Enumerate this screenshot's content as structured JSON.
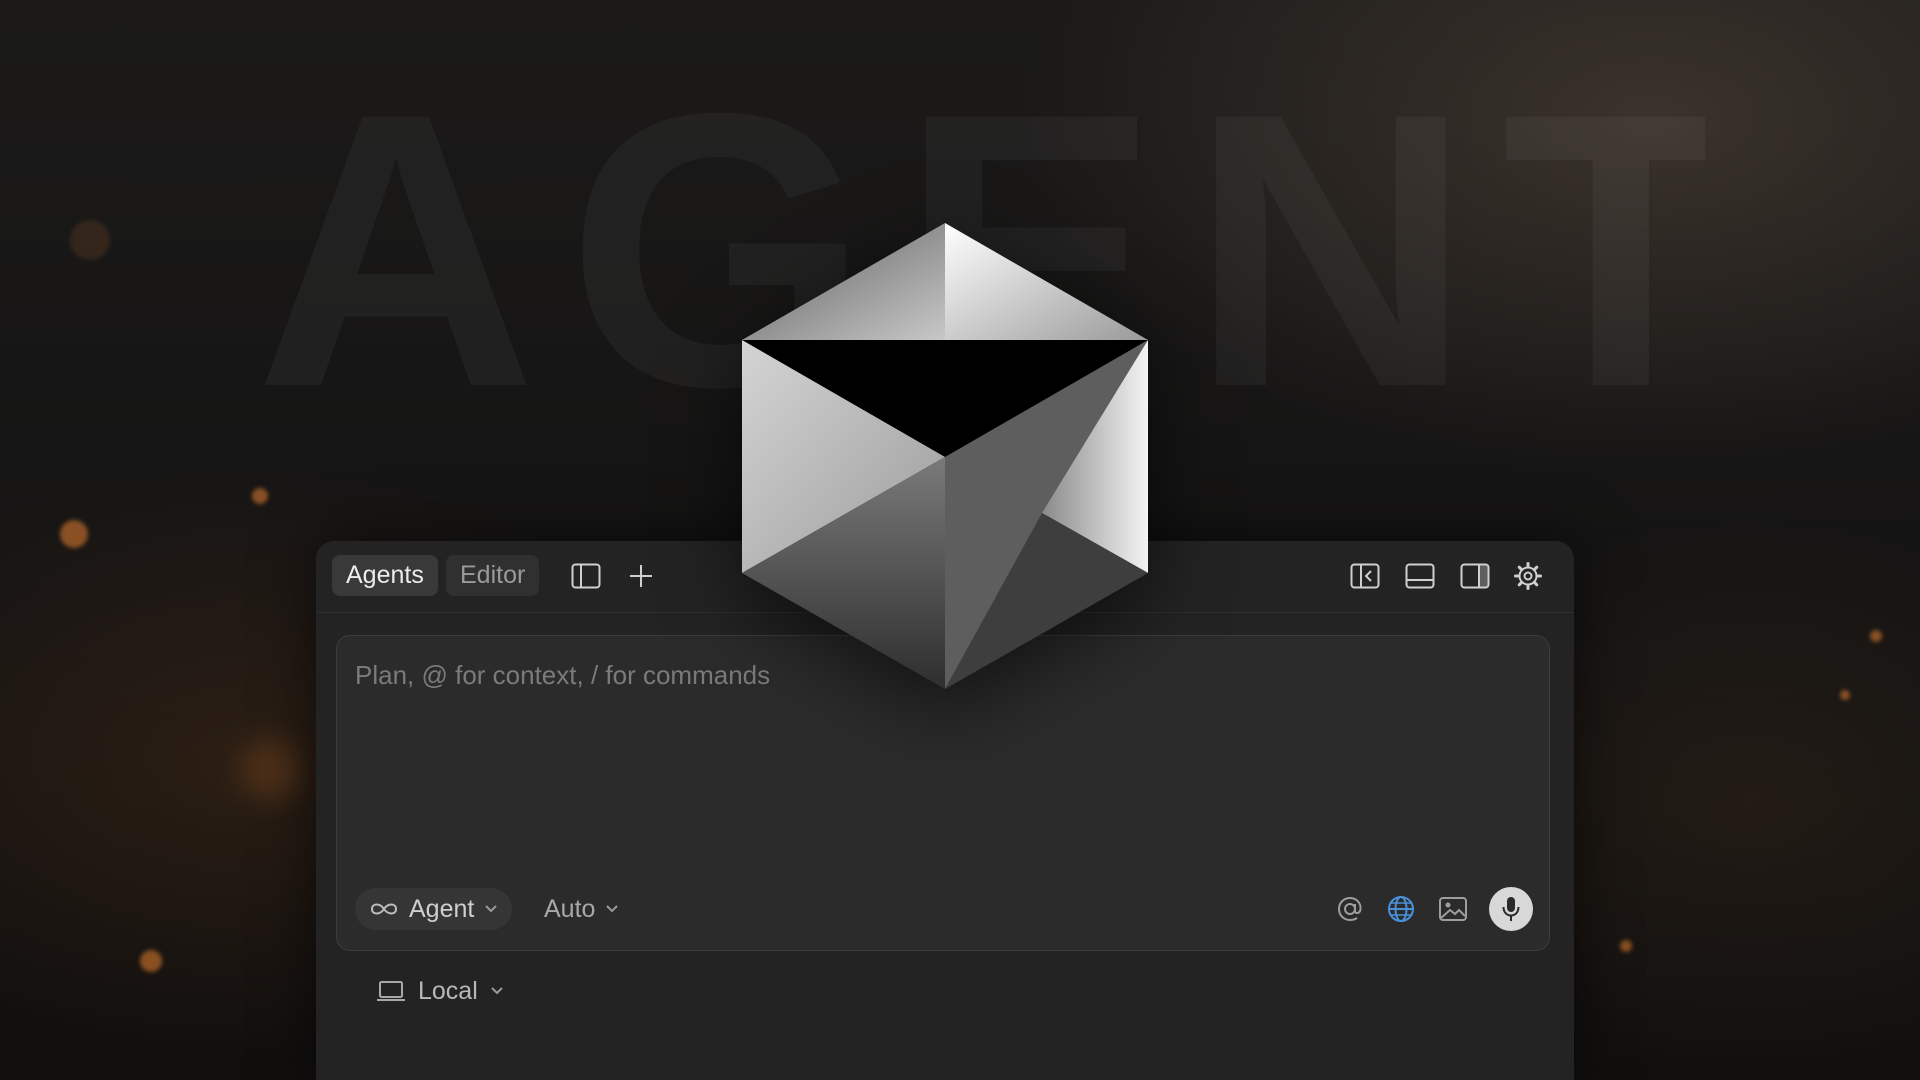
{
  "background": {
    "wordmark": "AGENT"
  },
  "topbar": {
    "tabs": [
      {
        "label": "Agents",
        "active": true
      },
      {
        "label": "Editor",
        "active": false
      }
    ],
    "left_icons": [
      "sidebar-toggle-icon",
      "plus-icon"
    ],
    "right_icons": [
      "collapse-left-panel-icon",
      "bottom-panel-icon",
      "right-panel-icon",
      "gear-icon"
    ]
  },
  "composer": {
    "placeholder": "Plan, @ for context, / for commands",
    "value": "",
    "mode": {
      "label": "Agent",
      "icon": "infinity-icon"
    },
    "model": {
      "label": "Auto"
    },
    "tools": [
      "at-mention-icon",
      "globe-icon",
      "image-icon",
      "microphone-icon"
    ]
  },
  "environment": {
    "label": "Local",
    "icon": "laptop-icon"
  },
  "colors": {
    "panel": "#232323",
    "composer": "#2b2b2b",
    "globe_accent": "#4a90d9",
    "mic_button": "#d8d8d8"
  }
}
